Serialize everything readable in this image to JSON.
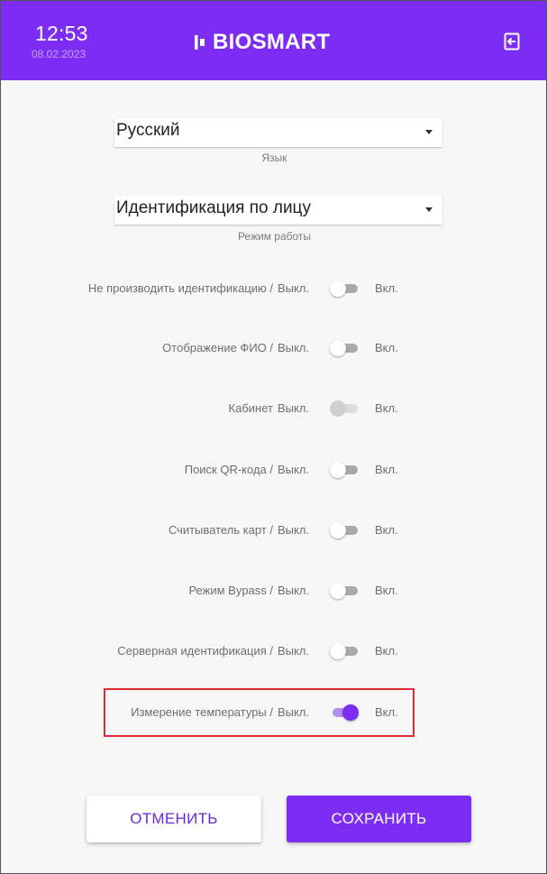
{
  "header": {
    "time": "12:53",
    "date": "08.02.2023",
    "logo_text": "BIOSMART",
    "exit_icon": "exit-icon",
    "background": "#7c2cf3"
  },
  "language": {
    "value": "Русский",
    "label": "Язык"
  },
  "mode": {
    "value": "Идентификация по лицу",
    "label": "Режим работы"
  },
  "settings": [
    {
      "label": "Не производить идентификацию /",
      "off": "Выкл.",
      "on": "Вкл.",
      "state": "off",
      "disabled": false
    },
    {
      "label": "Отображение ФИО /",
      "off": "Выкл.",
      "on": "Вкл.",
      "state": "off",
      "disabled": false
    },
    {
      "label": "Кабинет",
      "off": "Выкл.",
      "on": "Вкл.",
      "state": "off",
      "disabled": true
    },
    {
      "label": "Поиск QR-кода /",
      "off": "Выкл.",
      "on": "Вкл.",
      "state": "off",
      "disabled": false
    },
    {
      "label": "Считыватель карт /",
      "off": "Выкл.",
      "on": "Вкл.",
      "state": "off",
      "disabled": false
    },
    {
      "label": "Режим Bypass /",
      "off": "Выкл.",
      "on": "Вкл.",
      "state": "off",
      "disabled": false
    },
    {
      "label": "Серверная идентификация /",
      "off": "Выкл.",
      "on": "Вкл.",
      "state": "off",
      "disabled": false
    },
    {
      "label": "Измерение температуры /",
      "off": "Выкл.",
      "on": "Вкл.",
      "state": "on",
      "disabled": false
    }
  ],
  "buttons": {
    "cancel": "ОТМЕНИТЬ",
    "save": "СОХРАНИТЬ"
  },
  "colors": {
    "accent": "#7c2cf3",
    "highlight": "#e02a36"
  }
}
